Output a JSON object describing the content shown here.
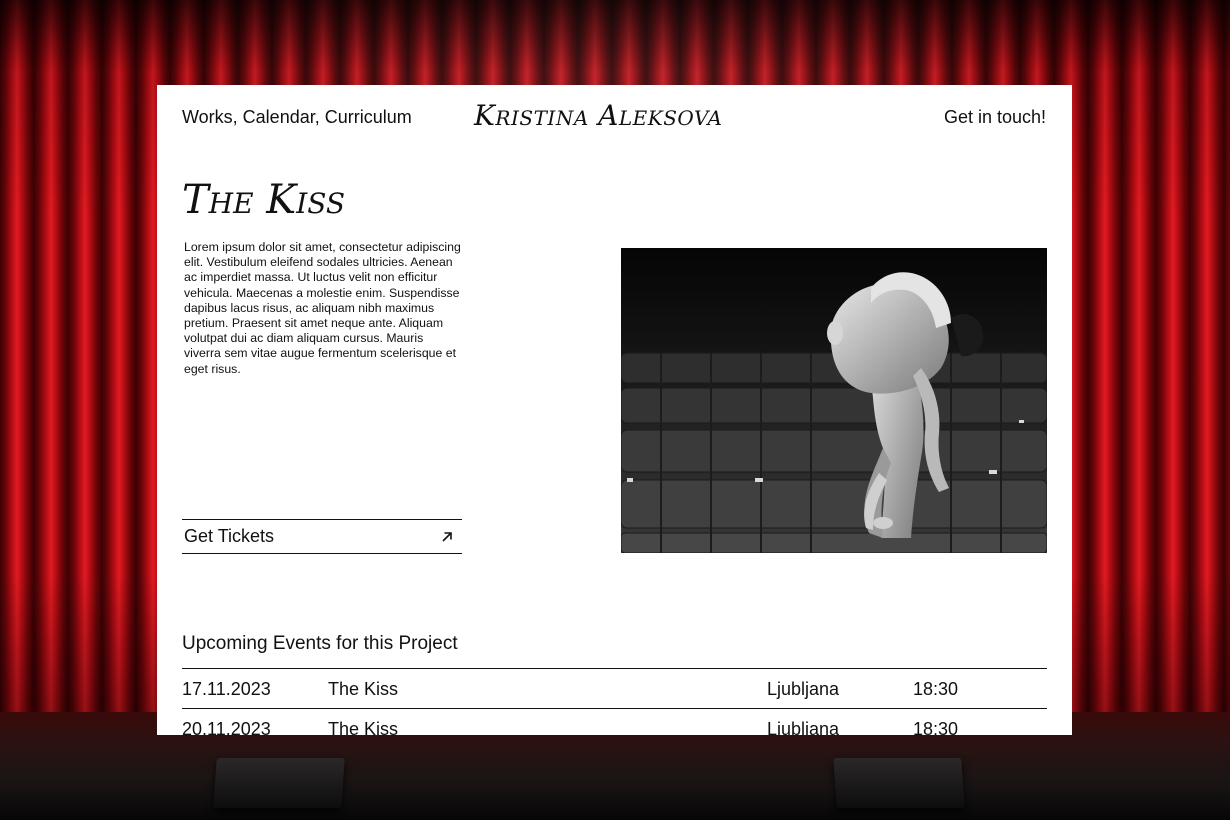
{
  "nav": {
    "links": "Works, Calendar, Curriculum",
    "logo": "Kristina Aleksova",
    "contact": "Get in touch!"
  },
  "project": {
    "title": "The Kiss",
    "description": "Lorem ipsum dolor sit amet, consectetur adipiscing elit. Vestibulum eleifend sodales ultricies. Aenean ac imperdiet massa. Ut luctus velit non efficitur vehicula. Maecenas a molestie enim. Suspendisse dapibus lacus risus, ac aliquam nibh maximus pretium. Praesent sit amet neque ante. Aliquam volutpat dui ac diam aliquam cursus. Mauris viverra sem vitae augue fermentum scelerisque et eget risus.",
    "tickets_label": "Get Tickets",
    "tickets_icon": "arrow-up-right-icon"
  },
  "events": {
    "heading": "Upcoming Events for this Project",
    "rows": [
      {
        "date": "17.11.2023",
        "title": "The Kiss",
        "city": "Ljubljana",
        "time": "18:30"
      },
      {
        "date": "20.11.2023",
        "title": "The Kiss",
        "city": "Ljubljana",
        "time": "18:30"
      }
    ]
  },
  "colors": {
    "curtain": "#c8101a",
    "card": "#ffffff",
    "text": "#111111"
  }
}
